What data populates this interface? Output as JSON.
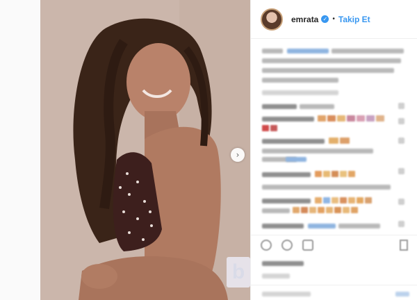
{
  "post": {
    "username": "emrata",
    "follow_label": "Takip Et",
    "separator": "•",
    "verified_glyph": "✓"
  },
  "photo": {
    "next_arrow_glyph": "›"
  },
  "watermark": {
    "glyph": "b"
  },
  "icons": [
    "heart-icon",
    "comment-icon",
    "share-icon",
    "bookmark-icon",
    "verified-icon",
    "chevron-right-icon"
  ],
  "colors": {
    "accent": "#3897f0",
    "border": "#efefef",
    "text": "#262626"
  }
}
